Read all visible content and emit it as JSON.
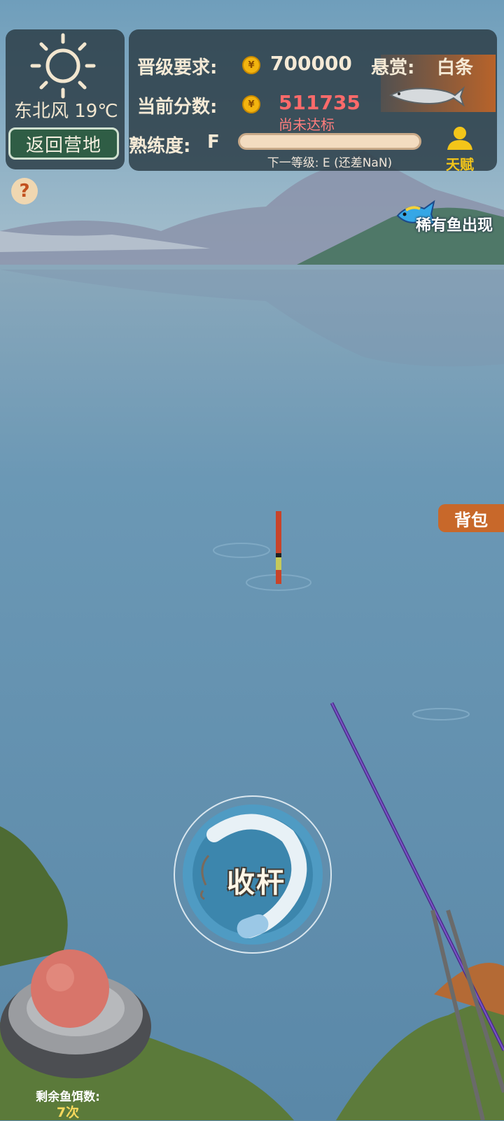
{
  "weather": {
    "icon": "sun-icon",
    "wind_text": "东北风 19℃",
    "back_label": "返回营地",
    "help_label": "?"
  },
  "stats": {
    "requirement_label": "晋级要求:",
    "requirement_value": "700000",
    "score_label": "当前分数:",
    "score_value": "511735",
    "score_status": "尚未达标",
    "proficiency_label": "熟练度:",
    "proficiency_grade": "F",
    "proficiency_progress": 0,
    "next_level_text": "下一等级: E (还差NaN)",
    "bounty_label": "悬赏:",
    "bounty_fish": "白条",
    "talent_label": "天赋",
    "coin_symbol": "¥"
  },
  "rare_fish_text": "稀有鱼出现",
  "bag_label": "背包",
  "reel_label": "收杆",
  "bait": {
    "label": "剩余鱼饵数:",
    "count": "7次"
  },
  "colors": {
    "panel": "#2d3e48",
    "score_red": "#ff6a6a",
    "status_red": "#ff7d7d",
    "accent_orange": "#c8682a",
    "gold": "#f3b40f"
  }
}
